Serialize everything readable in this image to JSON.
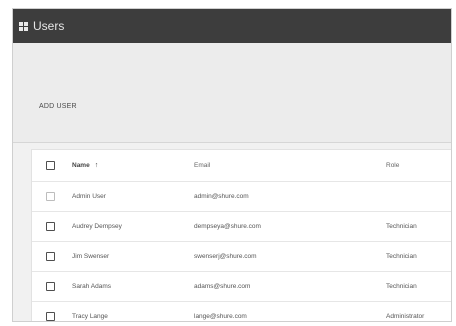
{
  "window": {
    "title": "Users"
  },
  "toolbar": {
    "add_user_label": "ADD USER"
  },
  "table": {
    "columns": {
      "name": "Name",
      "email": "Email",
      "role": "Role"
    },
    "sort_indicator": "↑",
    "rows": [
      {
        "name": "Admin User",
        "email": "admin@shure.com",
        "role": ""
      },
      {
        "name": "Audrey Dempsey",
        "email": "dempseya@shure.com",
        "role": "Technician"
      },
      {
        "name": "Jim Swenser",
        "email": "swenserj@shure.com",
        "role": "Technician"
      },
      {
        "name": "Sarah Adams",
        "email": "adams@shure.com",
        "role": "Technician"
      },
      {
        "name": "Tracy Lange",
        "email": "lange@shure.com",
        "role": "Administrator"
      }
    ]
  }
}
